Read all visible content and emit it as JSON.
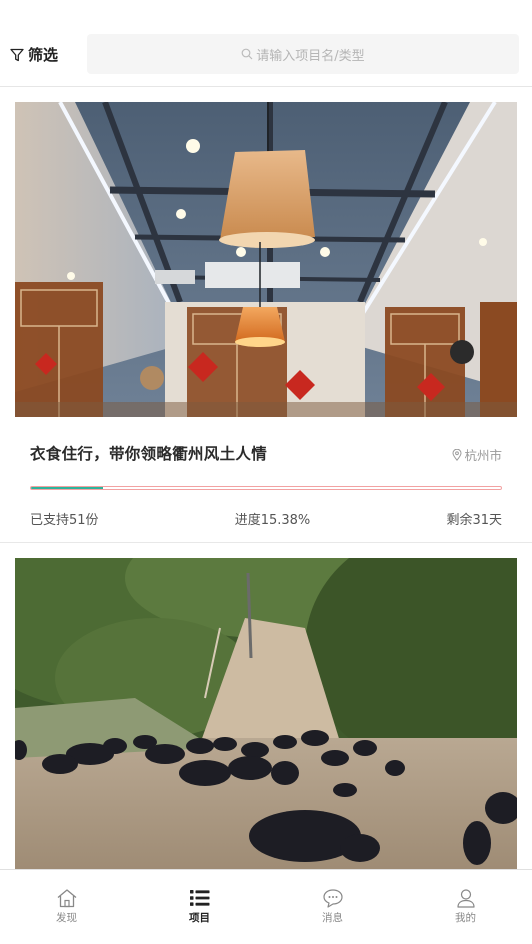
{
  "header": {
    "filter_label": "筛选",
    "filter_icon": "filter-icon",
    "search_placeholder": "请输入项目名/类型",
    "search_icon": "search-icon"
  },
  "projects": [
    {
      "title": "衣食住行，带你领略衢州风土人情",
      "location": "杭州市",
      "location_icon": "location-pin-icon",
      "progress_fraction": 0.1538,
      "supported": "已支持51份",
      "progress_text": "进度15.38%",
      "remaining": "剩余31天",
      "image": "restaurant-interior-photo"
    },
    {
      "image": "black-pigs-hillside-photo"
    }
  ],
  "tabbar": {
    "tabs": [
      {
        "label": "发现",
        "icon": "home-icon",
        "active": false
      },
      {
        "label": "项目",
        "icon": "list-icon",
        "active": true
      },
      {
        "label": "消息",
        "icon": "chat-icon",
        "active": false
      },
      {
        "label": "我的",
        "icon": "user-icon",
        "active": false
      }
    ]
  },
  "colors": {
    "progress_fill": "#2db39b",
    "progress_border": "#f2a2a2",
    "muted_text": "#9a9a9a",
    "active_tab": "#222222"
  }
}
